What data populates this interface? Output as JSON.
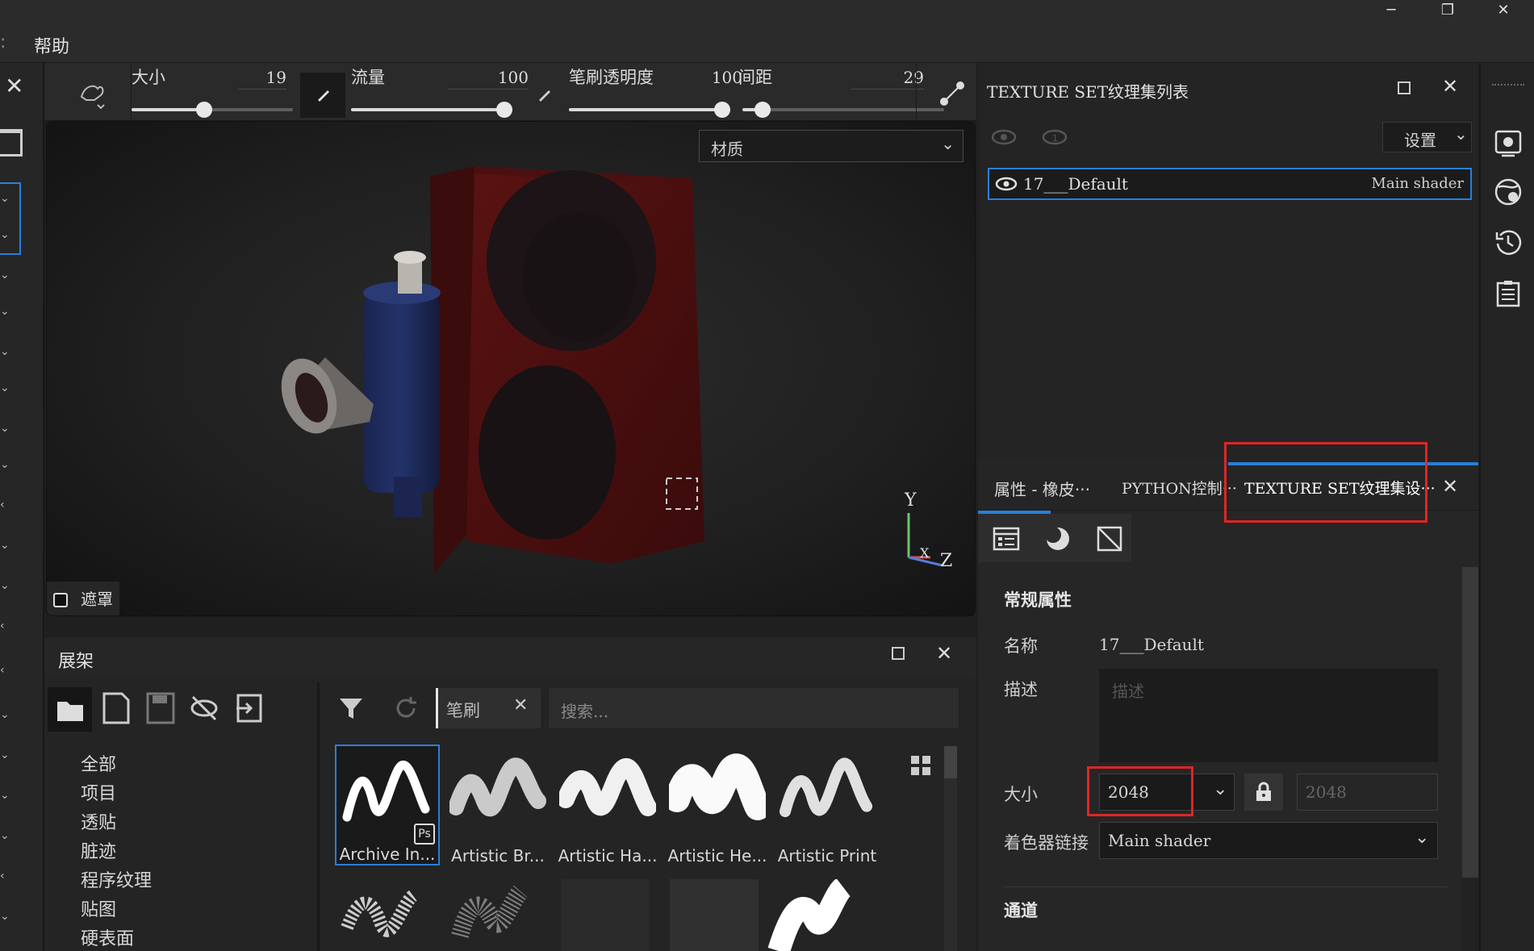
{
  "menu": {
    "item_help": "帮助"
  },
  "toolbar": {
    "size_label": "大小",
    "size_value": "19",
    "size_level": 0.45,
    "flow_label": "流量",
    "flow_value": "100",
    "flow_level": 1.0,
    "opacity_label": "笔刷透明度",
    "opacity_value": "100",
    "opacity_level": 1.0,
    "spacing_label": "间距",
    "spacing_value": "29",
    "spacing_level": 0.1
  },
  "viewport": {
    "dropdown_value": "材质",
    "mask_label": "遮罩",
    "axis_y": "Y",
    "axis_x": "X",
    "axis_z": "Z"
  },
  "shelf": {
    "title": "展架",
    "categories": [
      "全部",
      "项目",
      "透贴",
      "脏迹",
      "程序纹理",
      "贴图",
      "硬表面"
    ],
    "filter_tag": "笔刷",
    "search_placeholder": "搜索...",
    "thumbnails": [
      "Archive In...",
      "Artistic Br...",
      "Artistic Ha...",
      "Artistic He...",
      "Artistic Print"
    ],
    "ps_badge": "Ps"
  },
  "texture_set_list": {
    "title": "TEXTURE SET纹理集列表",
    "settings_label": "设置",
    "row_name": "17___Default",
    "row_shader": "Main shader"
  },
  "properties": {
    "tabs": [
      "属性 - 橡皮···",
      "PYTHON控制···",
      "TEXTURE SET纹理集设···"
    ],
    "section_general": "常规属性",
    "name_label": "名称",
    "name_value": "17___Default",
    "desc_label": "描述",
    "desc_placeholder": "描述",
    "size_label": "大小",
    "size_value": "2048",
    "size_value_locked": "2048",
    "shader_link_label": "着色器链接",
    "shader_link_value": "Main shader",
    "section_channels": "通道"
  },
  "colors": {
    "highlight_border": "#e02525",
    "selection_blue": "#2a7fd8"
  }
}
